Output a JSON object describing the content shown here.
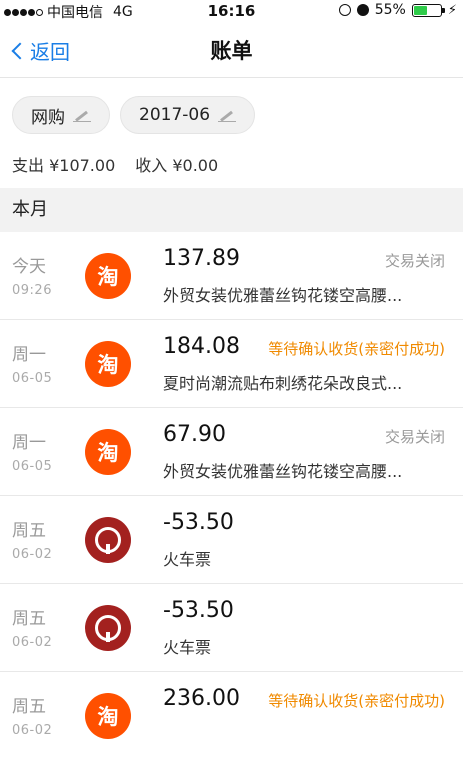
{
  "status_bar": {
    "carrier": "中国电信",
    "network": "4G",
    "time": "16:16",
    "battery": "55%",
    "battery_level": 0.55
  },
  "nav": {
    "back_label": "返回",
    "title": "账单"
  },
  "filters": {
    "category": "网购",
    "month": "2017-06"
  },
  "summary": {
    "expense": "支出 ¥107.00",
    "income": "收入 ¥0.00"
  },
  "section_title": "本月",
  "transactions": [
    {
      "day": "今天",
      "time": "09:26",
      "logo": "taobao-icon",
      "amount": "137.89",
      "status": "交易关闭",
      "desc": "外贸女装优雅蕾丝钩花镂空高腰..."
    },
    {
      "day": "周一",
      "time": "06-05",
      "logo": "taobao-icon",
      "amount": "184.08",
      "status": "等待确认收货(亲密付成功)",
      "desc": "夏时尚潮流贴布刺绣花朵改良式..."
    },
    {
      "day": "周一",
      "time": "06-05",
      "logo": "taobao-icon",
      "amount": "67.90",
      "status": "交易关闭",
      "desc": "外贸女装优雅蕾丝钩花镂空高腰..."
    },
    {
      "day": "周五",
      "time": "06-02",
      "logo": "railway-icon",
      "amount": "-53.50",
      "status": "",
      "desc": "火车票"
    },
    {
      "day": "周五",
      "time": "06-02",
      "logo": "railway-icon",
      "amount": "-53.50",
      "status": "",
      "desc": "火车票"
    },
    {
      "day": "周五",
      "time": "06-02",
      "logo": "taobao-icon",
      "amount": "236.00",
      "status": "等待确认收货(亲密付成功)",
      "desc": ""
    }
  ],
  "colors": {
    "accent": "#1a7ee6",
    "taobao": "#ff5000",
    "railway": "#a3211f",
    "pending": "#f08a00"
  }
}
